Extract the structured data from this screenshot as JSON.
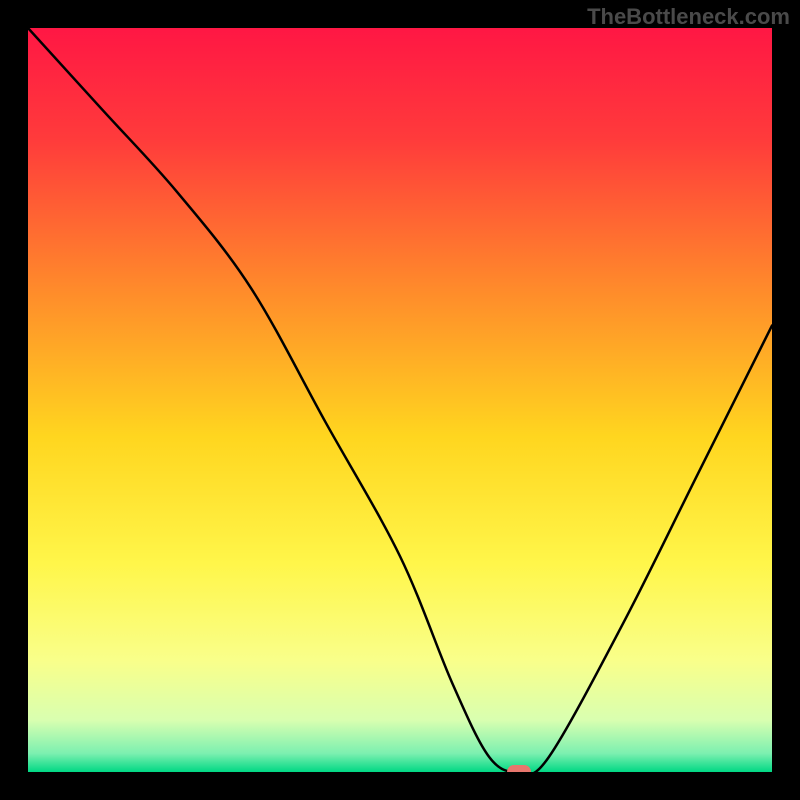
{
  "watermark": "TheBottleneck.com",
  "chart_data": {
    "type": "line",
    "title": "",
    "xlabel": "",
    "ylabel": "",
    "xlim": [
      0,
      100
    ],
    "ylim": [
      0,
      100
    ],
    "x": [
      0,
      10,
      20,
      30,
      40,
      50,
      57,
      62,
      66,
      70,
      80,
      90,
      100
    ],
    "values": [
      100,
      89,
      78,
      65,
      47,
      29,
      12,
      2,
      0,
      2,
      20,
      40,
      60
    ],
    "marker": {
      "x": 66,
      "y": 0,
      "color": "#e7766d"
    },
    "background_gradient": {
      "stops": [
        {
          "offset": 0.0,
          "color": "#ff1744"
        },
        {
          "offset": 0.15,
          "color": "#ff3b3b"
        },
        {
          "offset": 0.35,
          "color": "#ff8a2b"
        },
        {
          "offset": 0.55,
          "color": "#ffd61f"
        },
        {
          "offset": 0.72,
          "color": "#fff64a"
        },
        {
          "offset": 0.85,
          "color": "#f9ff8a"
        },
        {
          "offset": 0.93,
          "color": "#d9ffb0"
        },
        {
          "offset": 0.975,
          "color": "#7cf0b0"
        },
        {
          "offset": 1.0,
          "color": "#00d884"
        }
      ]
    }
  }
}
